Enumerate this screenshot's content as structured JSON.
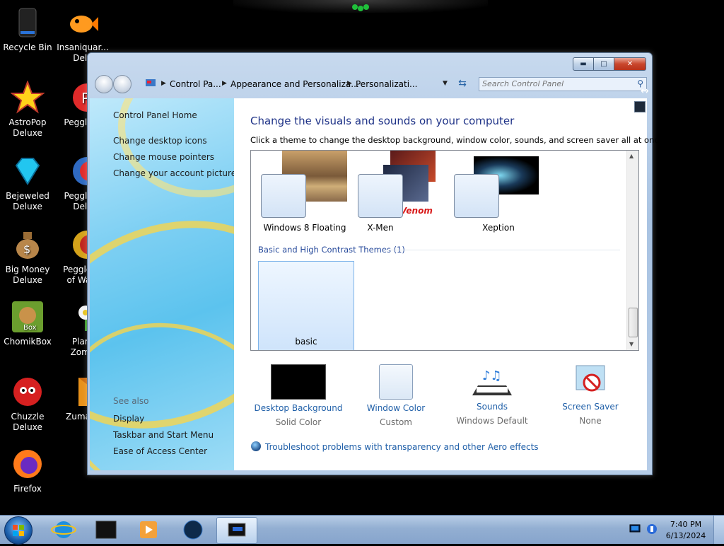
{
  "desktop": {
    "icons": [
      {
        "label": "Recycle Bin",
        "icon": "recycle-bin-icon"
      },
      {
        "label": "Insaniquar...\nDelu",
        "icon": "fish-game-icon"
      },
      {
        "label": "AstroPop\nDeluxe",
        "icon": "astropop-icon"
      },
      {
        "label": "Peggle D",
        "icon": "peggle-icon"
      },
      {
        "label": "Bejeweled\nDeluxe",
        "icon": "diamond-icon"
      },
      {
        "label": "Peggle N\nDelu",
        "icon": "peggle-nights-icon"
      },
      {
        "label": "Big Money\nDeluxe",
        "icon": "money-bag-icon"
      },
      {
        "label": "Peggle W\nof Warc",
        "icon": "peggle-wow-icon"
      },
      {
        "label": "ChomikBox",
        "icon": "chomikbox-icon"
      },
      {
        "label": "Plant\nZomb",
        "icon": "plants-zombies-icon"
      },
      {
        "label": "Chuzzle\nDeluxe",
        "icon": "chuzzle-icon"
      },
      {
        "label": "Zuma D",
        "icon": "zuma-icon"
      },
      {
        "label": "Firefox",
        "icon": "firefox-icon"
      }
    ]
  },
  "window": {
    "breadcrumb": {
      "items": [
        "Control Pa...",
        "Appearance and Personaliza...",
        "Personalizati..."
      ]
    },
    "search": {
      "placeholder": "Search Control Panel"
    },
    "left_pane": {
      "home": "Control Panel Home",
      "links": [
        "Change desktop icons",
        "Change mouse pointers",
        "Change your account picture"
      ],
      "see_also_title": "See also",
      "see_also": [
        "Display",
        "Taskbar and Start Menu",
        "Ease of Access Center"
      ]
    },
    "main": {
      "heading": "Change the visuals and sounds on your computer",
      "subtext": "Click a theme to change the desktop background, window color, sounds, and screen saver all at once.",
      "themes": [
        {
          "name": "Windows 8 Floating"
        },
        {
          "name": "X-Men"
        },
        {
          "name": "Xeption"
        }
      ],
      "group_title": "Basic and High Contrast Themes (1)",
      "basic_theme": {
        "name": "basic"
      },
      "options": [
        {
          "title": "Desktop Background",
          "value": "Solid Color",
          "icon": "desktop-background-icon"
        },
        {
          "title": "Window Color",
          "value": "Custom",
          "icon": "window-color-icon"
        },
        {
          "title": "Sounds",
          "value": "Windows Default",
          "icon": "sounds-icon"
        },
        {
          "title": "Screen Saver",
          "value": "None",
          "icon": "screen-saver-icon"
        }
      ],
      "troubleshoot": "Troubleshoot problems with transparency and other Aero effects"
    }
  },
  "taskbar": {
    "time": "7:40 PM",
    "date": "6/13/2024"
  },
  "colors": {
    "heading": "#1e3287",
    "link": "#1f5fa8",
    "taskbar": "#93afd2"
  }
}
